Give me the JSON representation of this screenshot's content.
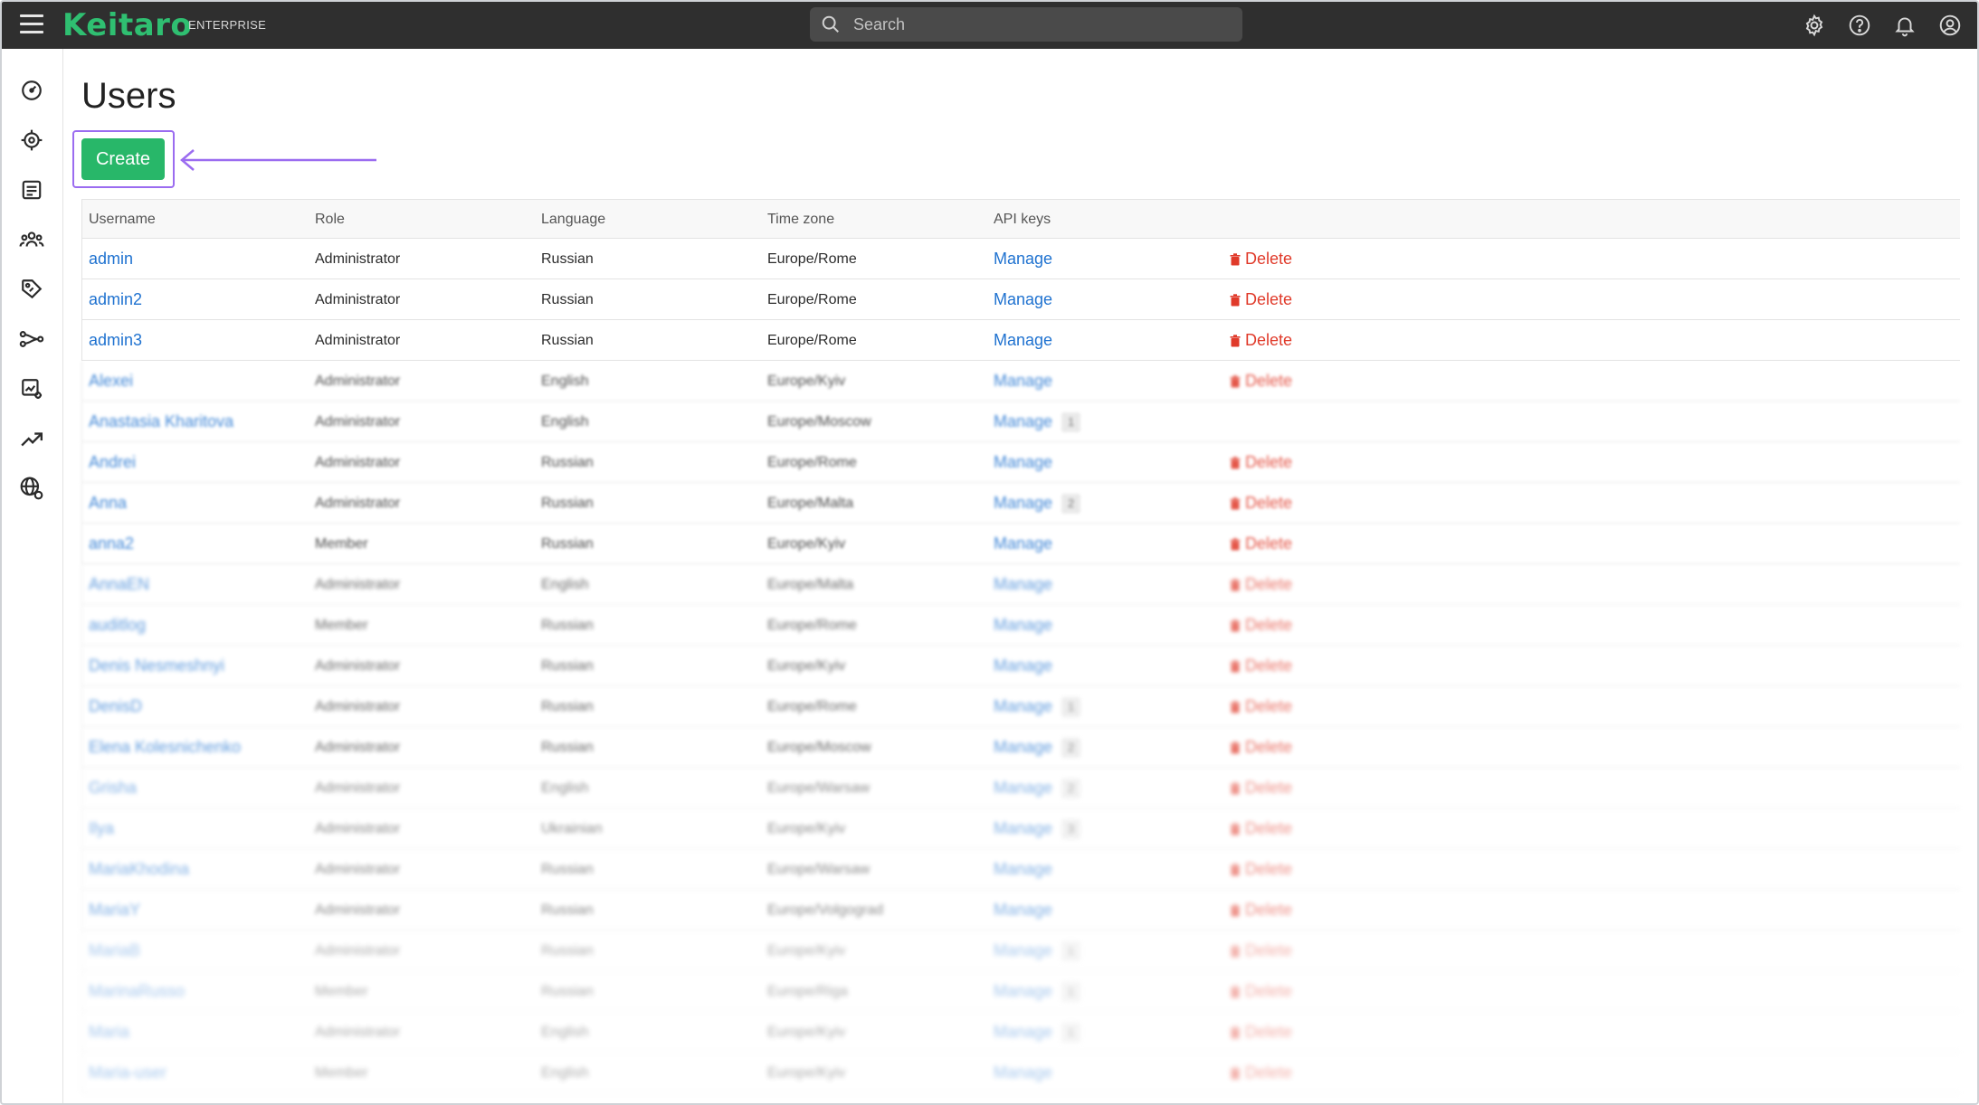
{
  "app": {
    "logo": "Keitaro",
    "edition": "ENTERPRISE"
  },
  "search": {
    "placeholder": "Search"
  },
  "page": {
    "title": "Users",
    "create_label": "Create"
  },
  "table": {
    "headers": [
      "Username",
      "Role",
      "Language",
      "Time zone",
      "API keys"
    ],
    "manage_label": "Manage",
    "delete_label": "Delete",
    "rows": [
      {
        "username": "admin",
        "role": "Administrator",
        "language": "Russian",
        "timezone": "Europe/Rome",
        "keys": "",
        "delete": true
      },
      {
        "username": "admin2",
        "role": "Administrator",
        "language": "Russian",
        "timezone": "Europe/Rome",
        "keys": "",
        "delete": true
      },
      {
        "username": "admin3",
        "role": "Administrator",
        "language": "Russian",
        "timezone": "Europe/Rome",
        "keys": "",
        "delete": true
      },
      {
        "username": "Alexei",
        "role": "Administrator",
        "language": "English",
        "timezone": "Europe/Kyiv",
        "keys": "",
        "delete": true
      },
      {
        "username": "Anastasia Kharitova",
        "role": "Administrator",
        "language": "English",
        "timezone": "Europe/Moscow",
        "keys": "1",
        "delete": false
      },
      {
        "username": "Andrei",
        "role": "Administrator",
        "language": "Russian",
        "timezone": "Europe/Rome",
        "keys": "",
        "delete": true
      },
      {
        "username": "Anna",
        "role": "Administrator",
        "language": "Russian",
        "timezone": "Europe/Malta",
        "keys": "2",
        "delete": true
      },
      {
        "username": "anna2",
        "role": "Member",
        "language": "Russian",
        "timezone": "Europe/Kyiv",
        "keys": "",
        "delete": true
      },
      {
        "username": "AnnaEN",
        "role": "Administrator",
        "language": "English",
        "timezone": "Europe/Malta",
        "keys": "",
        "delete": true
      },
      {
        "username": "auditlog",
        "role": "Member",
        "language": "Russian",
        "timezone": "Europe/Rome",
        "keys": "",
        "delete": true
      },
      {
        "username": "Denis Nesmeshnyi",
        "role": "Administrator",
        "language": "Russian",
        "timezone": "Europe/Kyiv",
        "keys": "",
        "delete": true
      },
      {
        "username": "DenisD",
        "role": "Administrator",
        "language": "Russian",
        "timezone": "Europe/Rome",
        "keys": "1",
        "delete": true
      },
      {
        "username": "Elena Kolesnichenko",
        "role": "Administrator",
        "language": "Russian",
        "timezone": "Europe/Moscow",
        "keys": "2",
        "delete": true
      },
      {
        "username": "Grisha",
        "role": "Administrator",
        "language": "English",
        "timezone": "Europe/Warsaw",
        "keys": "2",
        "delete": true
      },
      {
        "username": "Ilya",
        "role": "Administrator",
        "language": "Ukrainian",
        "timezone": "Europe/Kyiv",
        "keys": "3",
        "delete": true
      },
      {
        "username": "MariaKhodina",
        "role": "Administrator",
        "language": "Russian",
        "timezone": "Europe/Warsaw",
        "keys": "",
        "delete": true
      },
      {
        "username": "MariaY",
        "role": "Administrator",
        "language": "Russian",
        "timezone": "Europe/Volgograd",
        "keys": "",
        "delete": true
      },
      {
        "username": "MariaB",
        "role": "Administrator",
        "language": "Russian",
        "timezone": "Europe/Kyiv",
        "keys": "1",
        "delete": true
      },
      {
        "username": "MarinaRusso",
        "role": "Member",
        "language": "Russian",
        "timezone": "Europe/Riga",
        "keys": "1",
        "delete": true
      },
      {
        "username": "Maria",
        "role": "Administrator",
        "language": "English",
        "timezone": "Europe/Kyiv",
        "keys": "1",
        "delete": true
      },
      {
        "username": "Maria-user",
        "role": "Member",
        "language": "English",
        "timezone": "Europe/Kyiv",
        "keys": "",
        "delete": true
      }
    ]
  },
  "colors": {
    "brand": "#2fbf71",
    "topbar": "#2f2f2f",
    "link": "#1f72d0",
    "danger": "#e03a2a",
    "highlight": "#9b6cf0",
    "button": "#28b769"
  },
  "icons": {
    "topbar": [
      "settings-icon",
      "help-icon",
      "bell-icon",
      "account-icon"
    ],
    "sidebar": [
      "dashboard-icon",
      "campaigns-icon",
      "offers-icon",
      "users-icon",
      "tags-icon",
      "flows-icon",
      "reports-icon",
      "trends-icon",
      "domains-icon"
    ]
  }
}
